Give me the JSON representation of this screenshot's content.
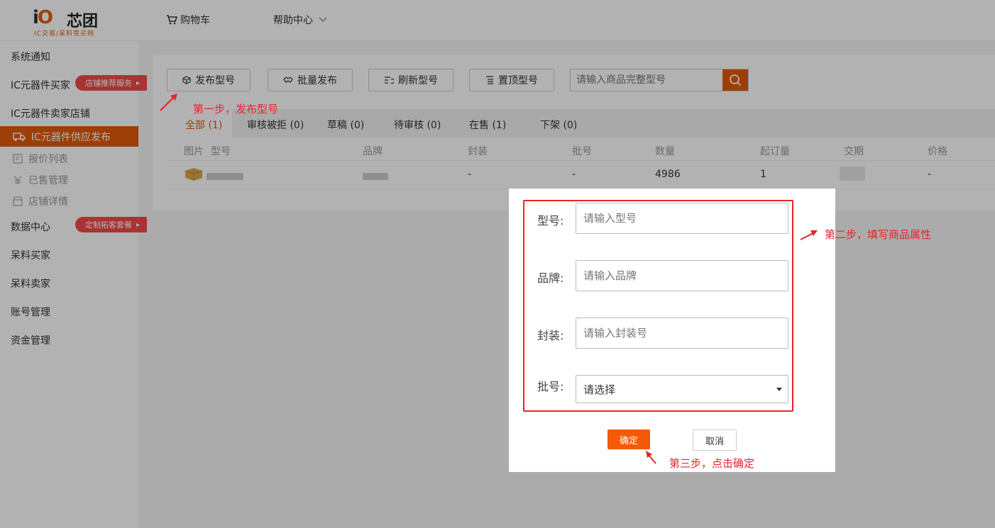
{
  "header": {
    "logo_mark": "iO",
    "logo_name": "芯团",
    "logo_sub": "IC交易/呆料竞买网",
    "cart": "购物车",
    "help": "帮助中心"
  },
  "sidebar": {
    "items": [
      {
        "label": "系统通知"
      },
      {
        "label": "IC元器件买家",
        "tag": "店铺推荐服务"
      },
      {
        "label": "IC元器件卖家店铺"
      },
      {
        "label": "IC元器件供应发布",
        "active": true
      },
      {
        "label": "报价列表"
      },
      {
        "label": "已售管理"
      },
      {
        "label": "店铺详情"
      },
      {
        "label": "数据中心",
        "tag": "定制拓客套餐"
      },
      {
        "label": "呆料买家"
      },
      {
        "label": "呆料卖家"
      },
      {
        "label": "账号管理"
      },
      {
        "label": "资金管理"
      }
    ]
  },
  "toolbar": {
    "publish": "发布型号",
    "batch": "批量发布",
    "refresh": "刷新型号",
    "top": "置顶型号",
    "search_placeholder": "请输入商品完整型号"
  },
  "tabs": [
    {
      "label": "全部 (1)",
      "active": true
    },
    {
      "label": "审核被拒 (0)"
    },
    {
      "label": "草稿 (0)"
    },
    {
      "label": "待审核 (0)"
    },
    {
      "label": "在售 (1)"
    },
    {
      "label": "下架 (0)"
    }
  ],
  "table": {
    "columns": [
      "图片",
      "型号",
      "品牌",
      "封装",
      "批号",
      "数量",
      "起订量",
      "交期",
      "价格"
    ],
    "rows": [
      {
        "package": "-",
        "batch": "-",
        "qty": "4986",
        "moq": "1",
        "price": "-"
      }
    ]
  },
  "dialog": {
    "model_label": "型号:",
    "model_placeholder": "请输入型号",
    "brand_label": "品牌:",
    "brand_placeholder": "请输入品牌",
    "package_label": "封装:",
    "package_placeholder": "请输入封装号",
    "batch_label": "批号:",
    "batch_value": "请选择",
    "confirm": "确定",
    "cancel": "取消"
  },
  "annotations": {
    "step1": "第一步，发布型号",
    "step2": "第二步，填写商品属性",
    "step3": "第三步，点击确定"
  },
  "colors": {
    "accent": "#e25a0b",
    "annotation_red": "#e8232a",
    "tag_red": "#f24a4a"
  }
}
